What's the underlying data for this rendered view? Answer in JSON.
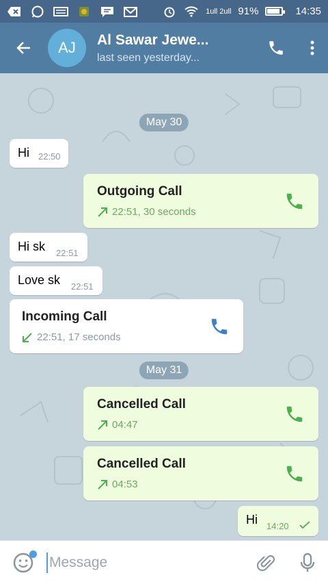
{
  "status_bar": {
    "signal_text": "1ull 2ull",
    "battery_percent": "91%",
    "battery_level": 0.91,
    "time": "14:35"
  },
  "header": {
    "avatar_initials": "AJ",
    "name": "Al Sawar Jewe...",
    "status": "last seen yesterday..."
  },
  "messages": {
    "date1": "May 30",
    "m1": {
      "text": "Hi",
      "time": "22:50"
    },
    "m2": {
      "title": "Outgoing Call",
      "detail": "22:51, 30 seconds"
    },
    "m3": {
      "text": "Hi sk",
      "time": "22:51"
    },
    "m4": {
      "text": "Love sk",
      "time": "22:51"
    },
    "m5": {
      "title": "Incoming Call",
      "detail": "22:51, 17 seconds"
    },
    "date2": "May 31",
    "m6": {
      "title": "Cancelled Call",
      "detail": "04:47"
    },
    "m7": {
      "title": "Cancelled Call",
      "detail": "04:53"
    },
    "m8": {
      "text": "Hi",
      "time": "14:20"
    }
  },
  "input": {
    "placeholder": "Message"
  },
  "colors": {
    "header": "#527da3",
    "status_bar": "#47678a",
    "outgoing_bubble": "#effdde",
    "call_green": "#4caf50",
    "call_blue": "#3f82c4"
  }
}
